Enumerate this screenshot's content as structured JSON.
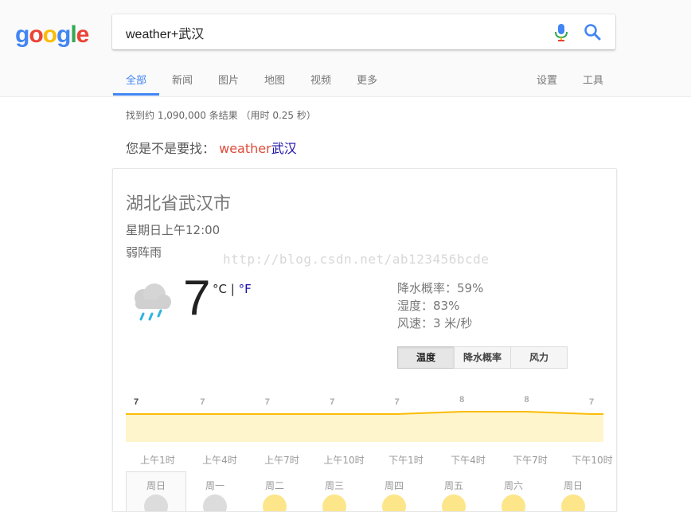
{
  "logo": {
    "letters": [
      "g",
      "o",
      "o",
      "g",
      "l",
      "e"
    ]
  },
  "search": {
    "value": "weather+武汉"
  },
  "tabs": [
    {
      "label": "全部"
    },
    {
      "label": "新闻"
    },
    {
      "label": "图片"
    },
    {
      "label": "地图"
    },
    {
      "label": "视频"
    },
    {
      "label": "更多"
    },
    {
      "label": "设置"
    },
    {
      "label": "工具"
    }
  ],
  "result_stats": "找到约 1,090,000 条结果 （用时 0.25 秒）",
  "did_you_mean": {
    "prefix": "您是不是要找：",
    "suggestion_a": "weather",
    "suggestion_b": "武汉"
  },
  "weather": {
    "location": "湖北省武汉市",
    "time": "星期日上午12:00",
    "condition": "弱阵雨",
    "temperature": "7",
    "unit_c": "°C",
    "unit_sep": " | ",
    "unit_f": "°F",
    "precip": "降水概率：59%",
    "humidity": "湿度：83%",
    "wind": "风速：3 米/秒",
    "toggle": [
      "温度",
      "降水概率",
      "风力"
    ],
    "watermark": "http://blog.csdn.net/ab123456bcde",
    "accent_color": "#fbbc05",
    "chart_data": {
      "type": "area",
      "x": [
        "上午1时",
        "上午4时",
        "上午7时",
        "上午10时",
        "下午1时",
        "下午4时",
        "下午7时",
        "下午10时"
      ],
      "values": [
        7,
        7,
        7,
        7,
        7,
        8,
        8,
        7
      ]
    },
    "days": [
      "周日",
      "周一",
      "周二",
      "周三",
      "周四",
      "周五",
      "周六",
      "周日"
    ]
  }
}
